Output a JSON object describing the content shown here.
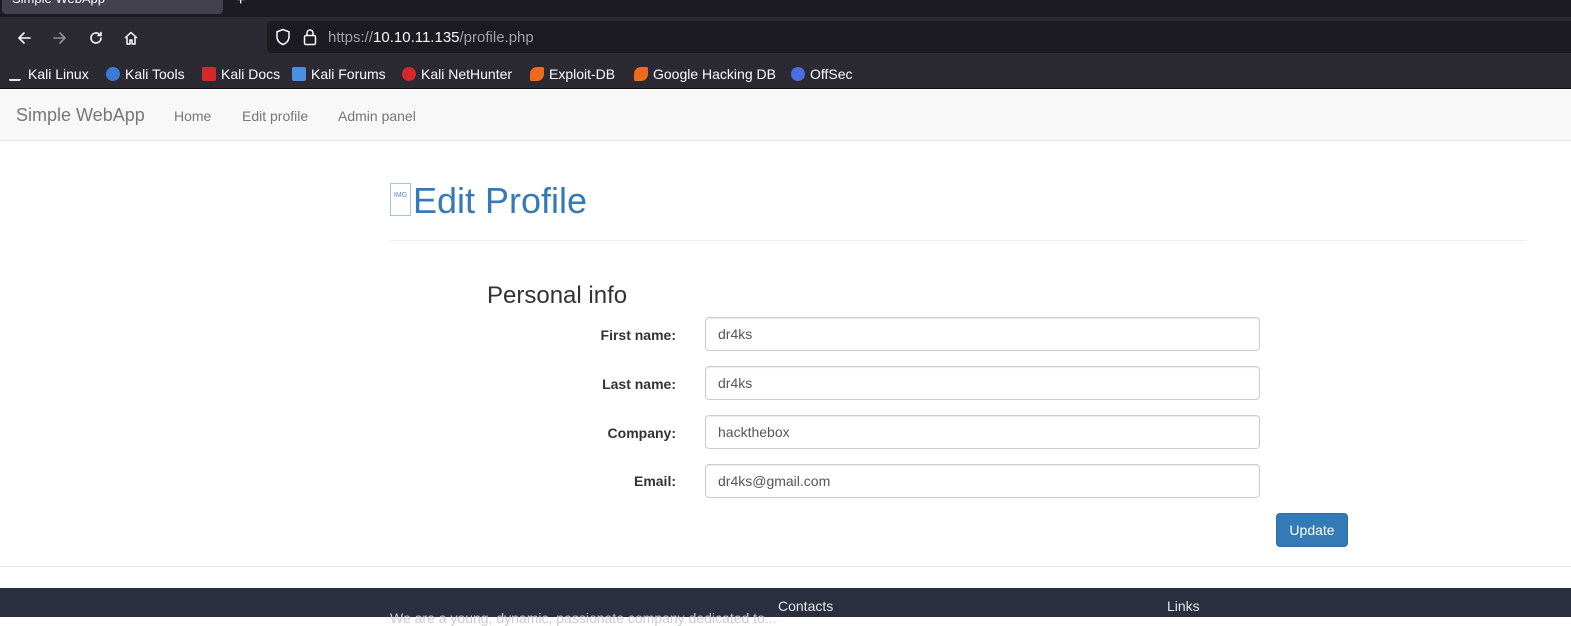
{
  "browser": {
    "tab_title": "Simple WebApp",
    "new_tab_symbol": "+",
    "url_scheme": "https://",
    "url_host": "10.10.11.135",
    "url_path": "/profile.php",
    "bookmarks": [
      {
        "label": "Kali Linux",
        "icon": "kali-dragon-icon",
        "color": "#e6e6e6"
      },
      {
        "label": "Kali Tools",
        "icon": "kali-tools-icon",
        "color": "#3a7bd5"
      },
      {
        "label": "Kali Docs",
        "icon": "kali-docs-icon",
        "color": "#d62828"
      },
      {
        "label": "Kali Forums",
        "icon": "kali-forums-icon",
        "color": "#4a90e2"
      },
      {
        "label": "Kali NetHunter",
        "icon": "nethunter-icon",
        "color": "#d62828"
      },
      {
        "label": "Exploit-DB",
        "icon": "exploit-db-icon",
        "color": "#f06a1d"
      },
      {
        "label": "Google Hacking DB",
        "icon": "ghdb-icon",
        "color": "#f06a1d"
      },
      {
        "label": "OffSec",
        "icon": "offsec-icon",
        "color": "#4b6ee0"
      }
    ]
  },
  "navbar": {
    "brand": "Simple WebApp",
    "links": [
      "Home",
      "Edit profile",
      "Admin panel"
    ]
  },
  "main": {
    "title": "Edit Profile",
    "avatar_alt": "IMG",
    "section_title": "Personal info",
    "fields": [
      {
        "label": "First name:",
        "value": "dr4ks"
      },
      {
        "label": "Last name:",
        "value": "dr4ks"
      },
      {
        "label": "Company:",
        "value": "hackthebox"
      },
      {
        "label": "Email:",
        "value": "dr4ks@gmail.com"
      }
    ],
    "submit_label": "Update"
  },
  "footer": {
    "about_text": "We are a young, dynamic, passionate company dedicated to...",
    "contacts_heading": "Contacts",
    "links_heading": "Links"
  }
}
